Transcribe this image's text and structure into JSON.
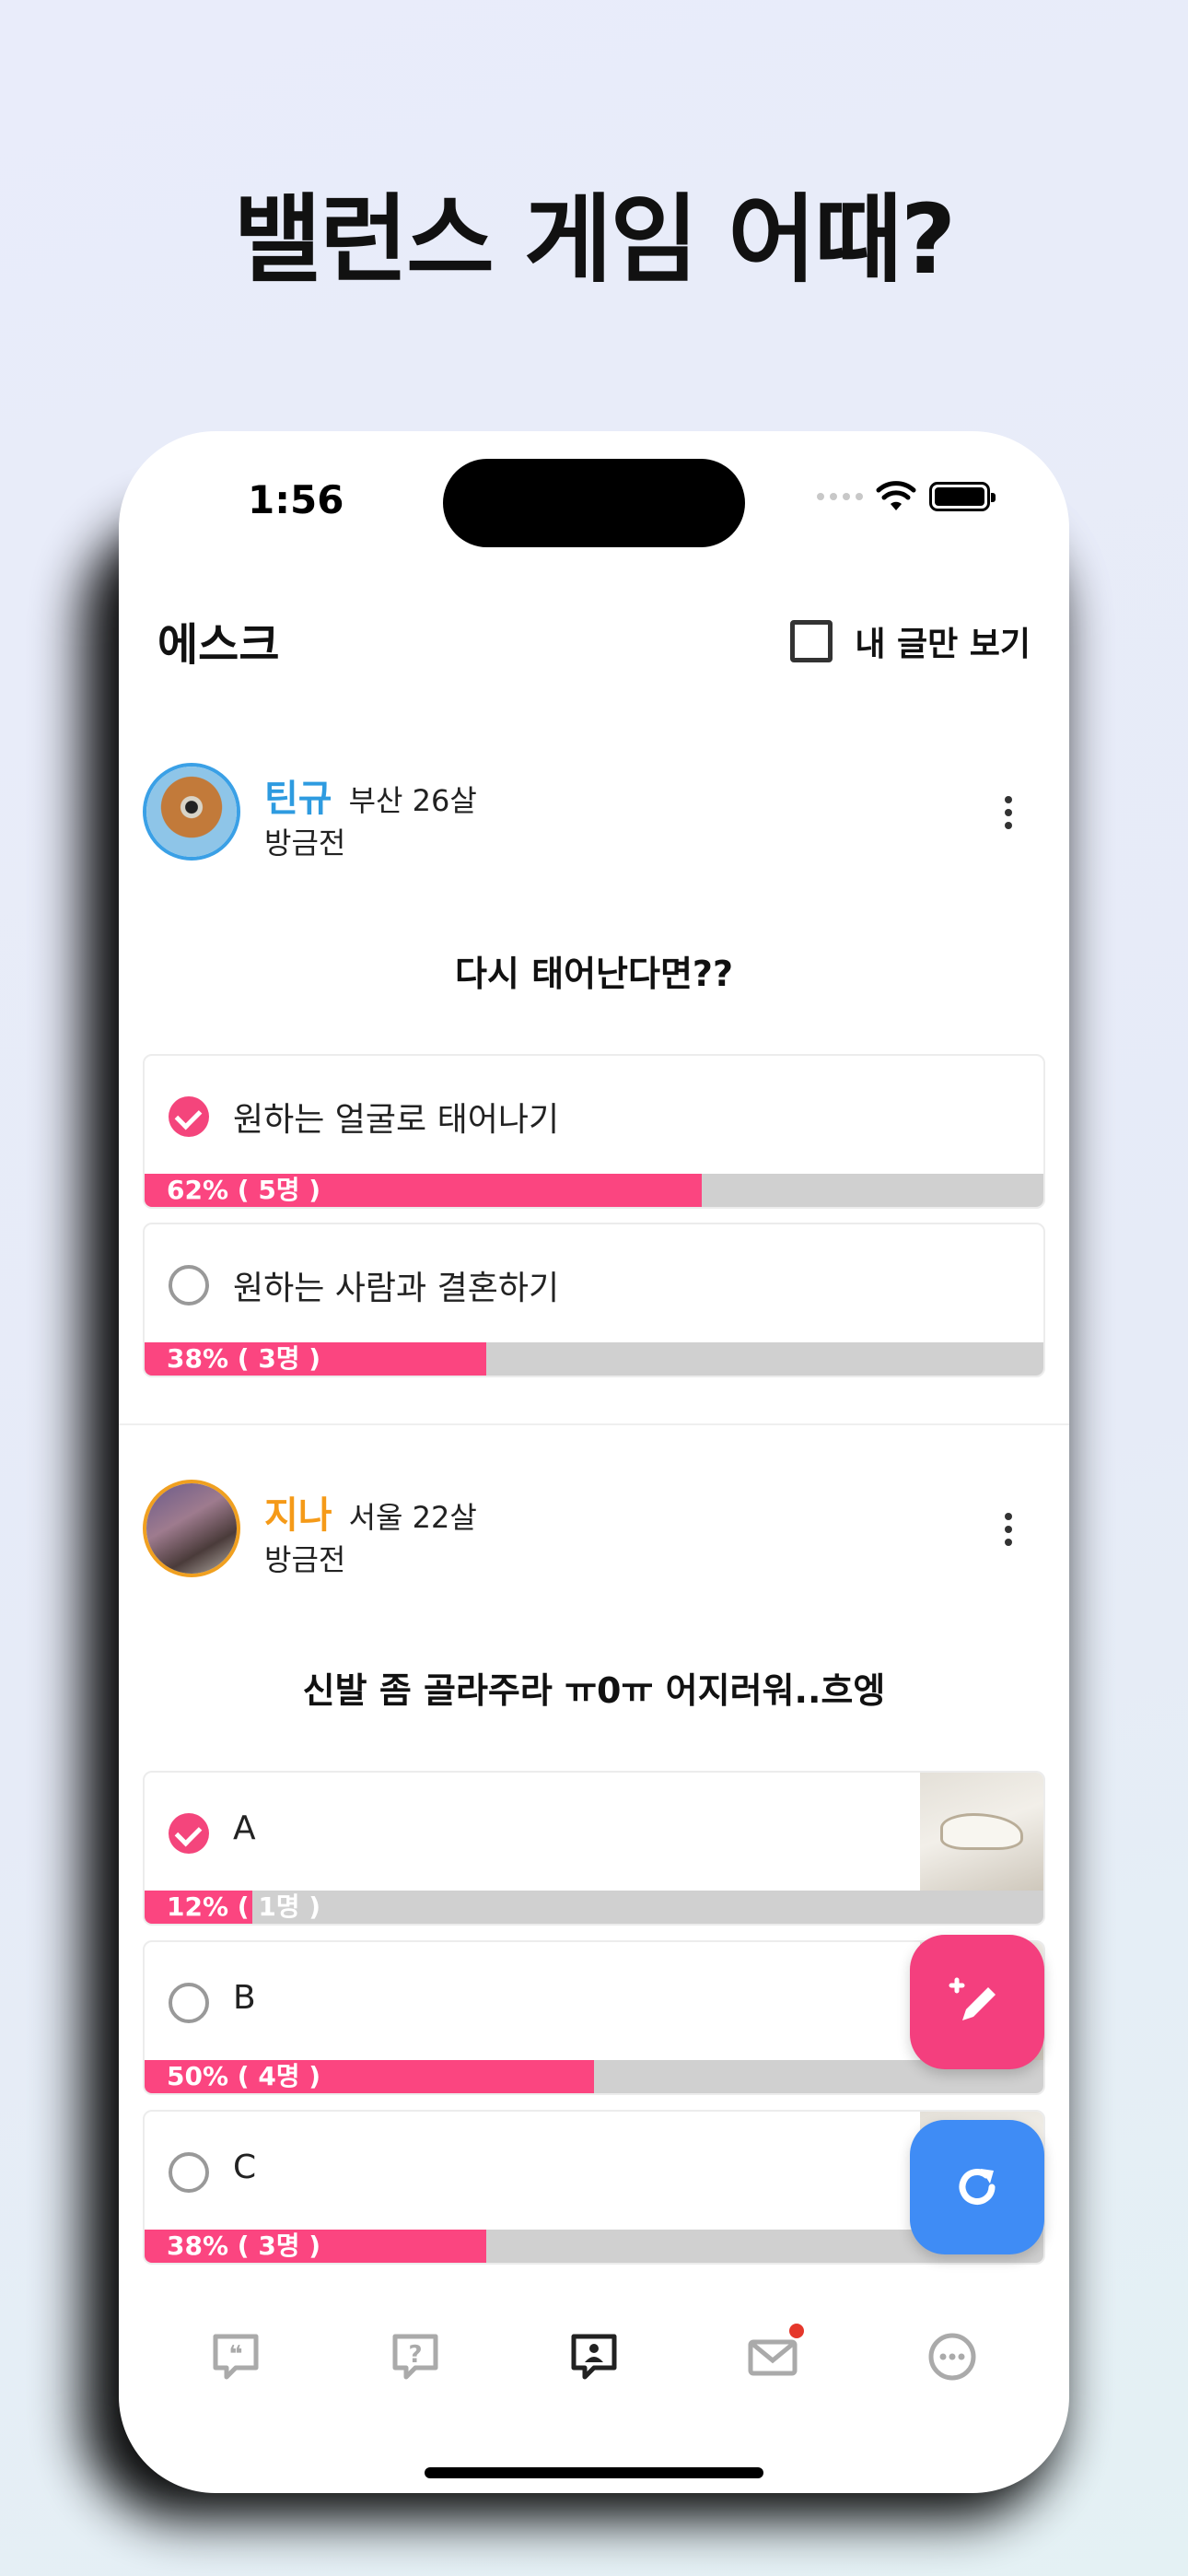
{
  "headline": "밸런스 게임 어때?",
  "status_bar": {
    "time": "1:56"
  },
  "header": {
    "title": "에스크",
    "filter_label": "내 글만 보기"
  },
  "posts": [
    {
      "author": "틴규",
      "meta": "부산 26살",
      "time": "방금전",
      "question": "다시 태어난다면??",
      "options": [
        {
          "label": "원하는 얼굴로 태어나기",
          "percent_text": "62% ( 5명 )",
          "fraction": 0.62,
          "checked": true
        },
        {
          "label": "원하는 사람과 결혼하기",
          "percent_text": "38% ( 3명 )",
          "fraction": 0.38,
          "checked": false
        }
      ]
    },
    {
      "author": "지나",
      "meta": "서울 22살",
      "time": "방금전",
      "question": "신발 좀 골라주라 ㅠ0ㅠ 어지러워..흐엥",
      "options": [
        {
          "label": "A",
          "percent_text": "12% ( 1명 )",
          "fraction": 0.12,
          "checked": true
        },
        {
          "label": "B",
          "percent_text": "50% ( 4명 )",
          "fraction": 0.5,
          "checked": false
        },
        {
          "label": "C",
          "percent_text": "38% ( 3명 )",
          "fraction": 0.38,
          "checked": false
        }
      ]
    }
  ],
  "tabbar": {
    "icons": [
      "quote-bubble-icon",
      "question-icon",
      "ask-icon",
      "mail-icon",
      "more-icon"
    ],
    "active_index": 2
  },
  "colors": {
    "accent_pink": "#f4457c",
    "accent_blue": "#3f8cf5",
    "name_blue": "#2e9be0",
    "name_orange": "#f59a18"
  }
}
